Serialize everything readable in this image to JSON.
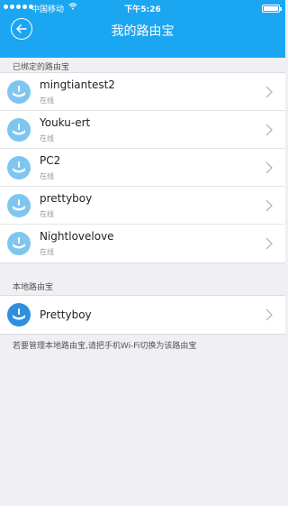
{
  "status_bar": {
    "carrier": "中国移动",
    "time": "下午5:26"
  },
  "header": {
    "title": "我的路由宝",
    "back_icon": "back-arrow-icon"
  },
  "bound_section": {
    "label": "已绑定的路由宝",
    "routers": [
      {
        "name": "mingtiantest2",
        "status": "在线"
      },
      {
        "name": "Youku-ert",
        "status": "在线"
      },
      {
        "name": "PC2",
        "status": "在线"
      },
      {
        "name": "prettyboy",
        "status": "在线"
      },
      {
        "name": "Nightlovelove",
        "status": "在线"
      }
    ]
  },
  "local_section": {
    "label": "本地路由宝",
    "routers": [
      {
        "name": "Prettyboy"
      }
    ]
  },
  "note": "若要管理本地路由宝,请把手机Wi-Fi切换为该路由宝",
  "colors": {
    "accent": "#1ba6f2",
    "online_avatar": "#7ec6f0",
    "local_avatar": "#2f8fde"
  }
}
